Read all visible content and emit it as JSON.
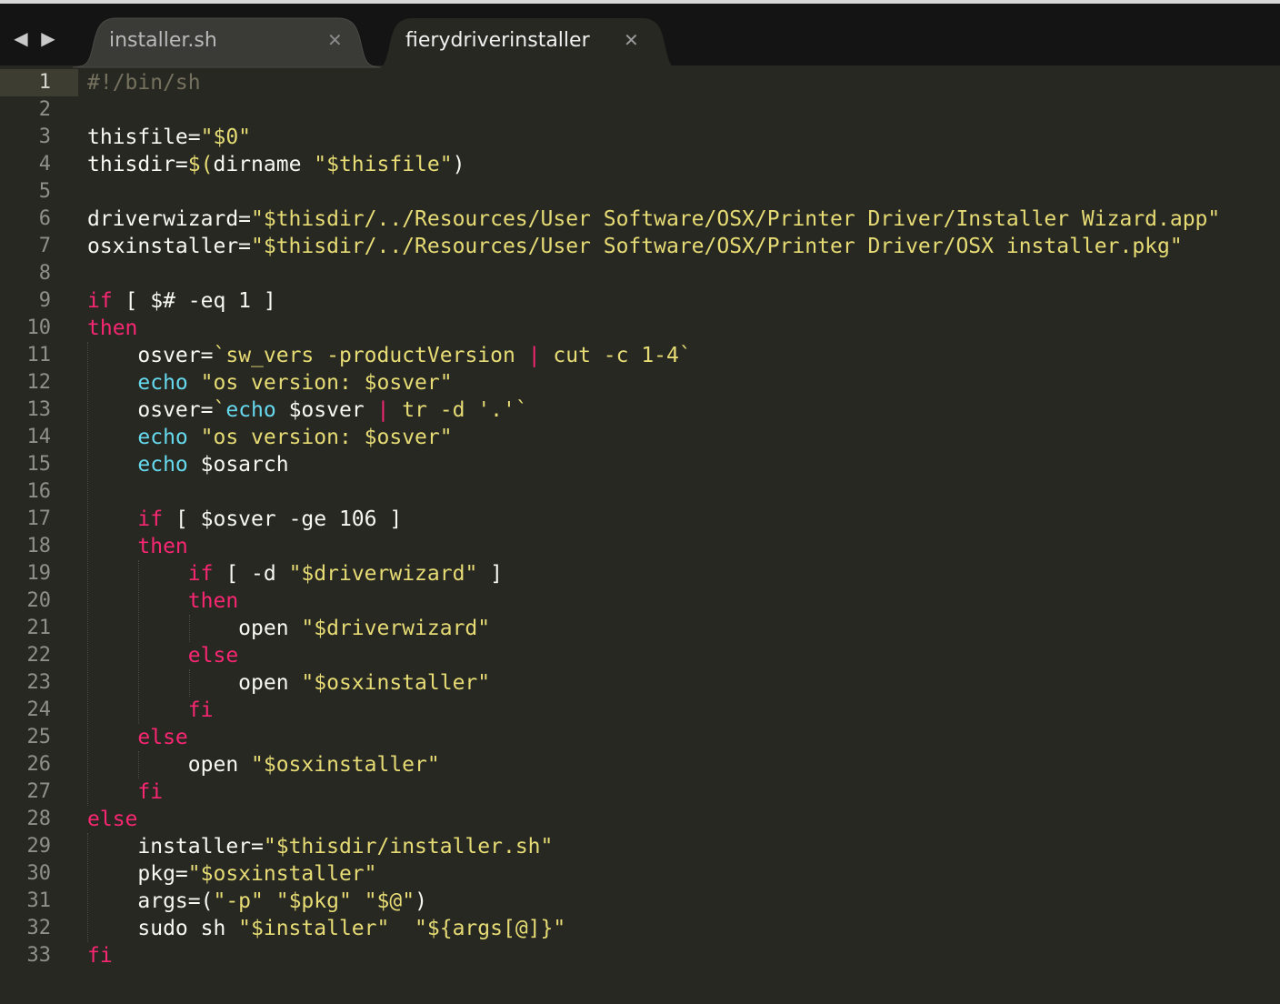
{
  "colors": {
    "background": "#272822",
    "tabbar": "#141414",
    "keyword": "#f92672",
    "string": "#e6db74",
    "builtin": "#66d9ef",
    "comment": "#75715e",
    "text": "#f8f8f2",
    "line_number": "#8f908a"
  },
  "nav": {
    "back_icon": "◀",
    "forward_icon": "▶"
  },
  "tabs": [
    {
      "label": "installer.sh",
      "close": "✕",
      "active": false
    },
    {
      "label": "fierydriverinstaller",
      "close": "✕",
      "active": true
    }
  ],
  "editor": {
    "current_line": 1,
    "lines": [
      {
        "n": "1",
        "t": "#!/bin/sh"
      },
      {
        "n": "2",
        "t": ""
      },
      {
        "n": "3",
        "t": "thisfile=\"$0\""
      },
      {
        "n": "4",
        "t": "thisdir=$(dirname \"$thisfile\")"
      },
      {
        "n": "5",
        "t": ""
      },
      {
        "n": "6",
        "t": "driverwizard=\"$thisdir/../Resources/User Software/OSX/Printer Driver/Installer Wizard.app\""
      },
      {
        "n": "7",
        "t": "osxinstaller=\"$thisdir/../Resources/User Software/OSX/Printer Driver/OSX installer.pkg\""
      },
      {
        "n": "8",
        "t": ""
      },
      {
        "n": "9",
        "t": "if [ $# -eq 1 ]"
      },
      {
        "n": "10",
        "t": "then"
      },
      {
        "n": "11",
        "t": "    osver=`sw_vers -productVersion | cut -c 1-4`"
      },
      {
        "n": "12",
        "t": "    echo \"os version: $osver\""
      },
      {
        "n": "13",
        "t": "    osver=`echo $osver | tr -d '.'`"
      },
      {
        "n": "14",
        "t": "    echo \"os version: $osver\""
      },
      {
        "n": "15",
        "t": "    echo $osarch"
      },
      {
        "n": "16",
        "t": ""
      },
      {
        "n": "17",
        "t": "    if [ $osver -ge 106 ]"
      },
      {
        "n": "18",
        "t": "    then"
      },
      {
        "n": "19",
        "t": "        if [ -d \"$driverwizard\" ]"
      },
      {
        "n": "20",
        "t": "        then"
      },
      {
        "n": "21",
        "t": "            open \"$driverwizard\""
      },
      {
        "n": "22",
        "t": "        else"
      },
      {
        "n": "23",
        "t": "            open \"$osxinstaller\""
      },
      {
        "n": "24",
        "t": "        fi"
      },
      {
        "n": "25",
        "t": "    else"
      },
      {
        "n": "26",
        "t": "        open \"$osxinstaller\""
      },
      {
        "n": "27",
        "t": "    fi"
      },
      {
        "n": "28",
        "t": "else"
      },
      {
        "n": "29",
        "t": "    installer=\"$thisdir/installer.sh\""
      },
      {
        "n": "30",
        "t": "    pkg=\"$osxinstaller\""
      },
      {
        "n": "31",
        "t": "    args=(\"-p\" \"$pkg\" \"$@\")"
      },
      {
        "n": "32",
        "t": "    sudo sh \"$installer\"  \"${args[@]}\""
      },
      {
        "n": "33",
        "t": "fi"
      }
    ]
  }
}
